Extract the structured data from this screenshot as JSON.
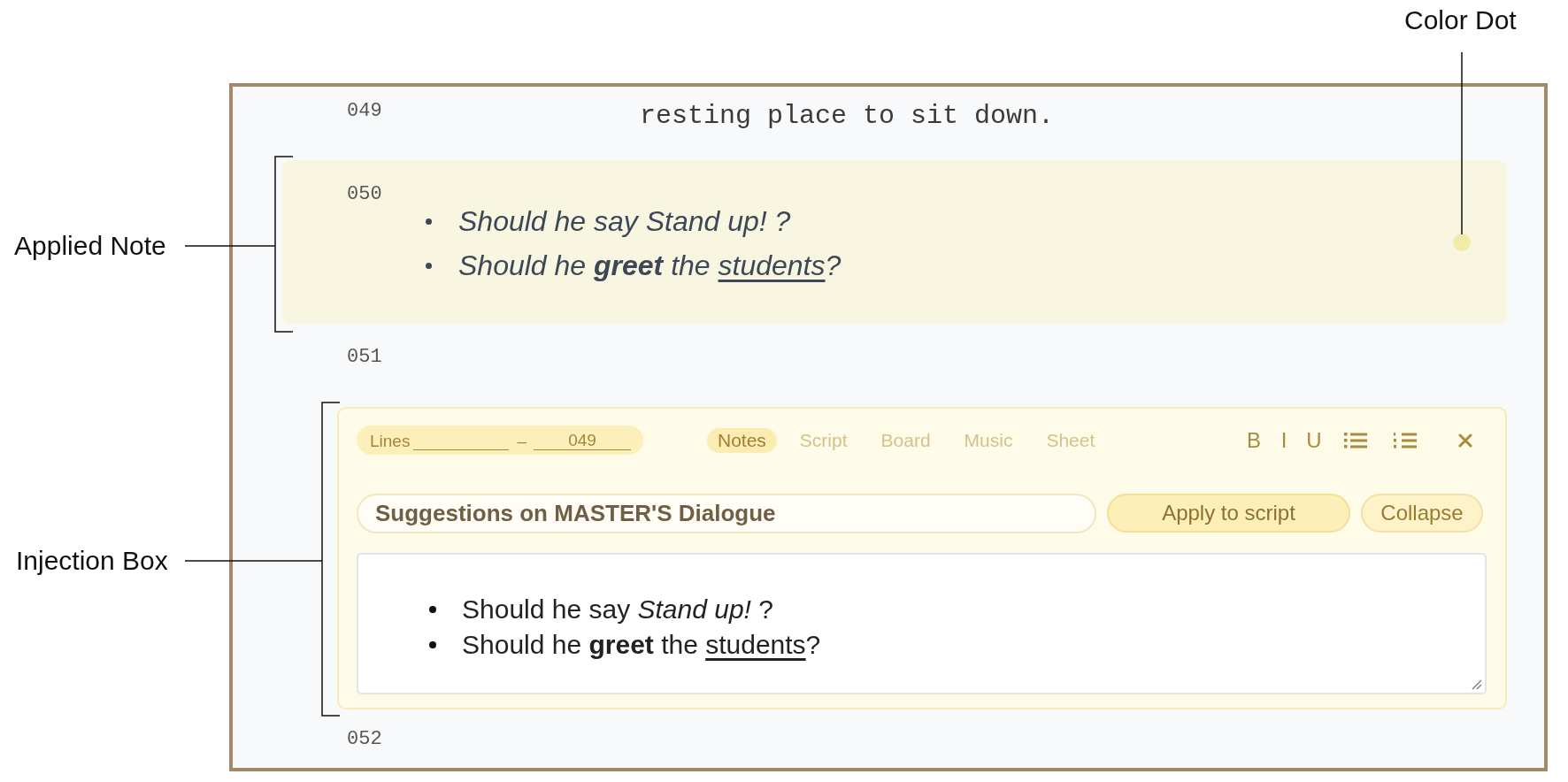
{
  "callouts": [
    {
      "kind": "bracket",
      "label": "Applied Note"
    },
    {
      "kind": "bracket",
      "label": "Injection Box"
    },
    {
      "kind": "pointer",
      "label": "Color Dot"
    }
  ],
  "script": {
    "lines": [
      {
        "kind": "text",
        "number": "049",
        "text": "resting place to sit down."
      },
      {
        "kind": "note",
        "number": "050",
        "color": "#f1eaa9",
        "items": [
          {
            "runs": [
              {
                "text": "Should he say Stand up! ?"
              }
            ]
          },
          {
            "runs": [
              {
                "text": "Should he **greet** the "
              },
              {
                "text": "students",
                "underlined": true
              },
              {
                "text": "?"
              }
            ]
          }
        ]
      },
      {
        "kind": "text",
        "number": "051"
      },
      {
        "kind": "injection",
        "line_range": {
          "label": "Lines",
          "separator": "–",
          "to": "049"
        },
        "tabs": [
          {
            "label": "Notes",
            "selected": true
          },
          {
            "label": "Script",
            "selected": false
          },
          {
            "label": "Board",
            "selected": false
          },
          {
            "label": "Music",
            "selected": false
          },
          {
            "label": "Sheet",
            "selected": false
          }
        ],
        "toolbar": [
          {
            "kind": "bold",
            "label": "B"
          },
          {
            "kind": "italic",
            "label": "I"
          },
          {
            "kind": "underline",
            "label": "U"
          },
          {
            "kind": "bullet_list"
          },
          {
            "kind": "numbered_list"
          },
          {
            "kind": "close"
          }
        ],
        "title_field": {
          "value": "Suggestions on MASTER'S Dialogue"
        },
        "buttons": [
          {
            "kind": "primary",
            "label": "Apply to script"
          },
          {
            "kind": "secondary",
            "label": "Collapse"
          }
        ],
        "editor": {
          "items": [
            {
              "runs": [
                {
                  "text": "Should he say *Stand up!* ?"
                }
              ]
            },
            {
              "runs": [
                {
                  "text": "Should he **greet** the "
                },
                {
                  "text": "students",
                  "underlined": true
                },
                {
                  "text": "?"
                }
              ]
            }
          ]
        }
      },
      {
        "kind": "text",
        "number": "052"
      }
    ]
  }
}
